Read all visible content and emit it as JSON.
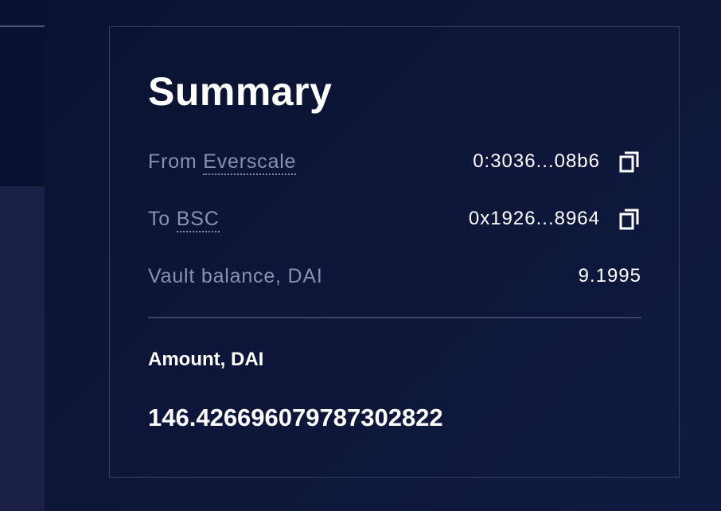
{
  "summary": {
    "title": "Summary",
    "rows": [
      {
        "label_prefix": "From",
        "label_link": "Everscale",
        "value": "0:3036...08b6",
        "copy_icon": "copy-icon"
      },
      {
        "label_prefix": "To",
        "label_link": "BSC",
        "value": "0x1926...8964",
        "copy_icon": "copy-icon"
      },
      {
        "label": "Vault balance, DAI",
        "value": "9.1995"
      }
    ],
    "amount_label": "Amount, DAI",
    "amount_value": "146.426696079787302822"
  },
  "colors": {
    "background": "#0d1638",
    "card_border": "#363f66",
    "muted_text": "#8a91ad",
    "primary_text": "#ffffff"
  }
}
